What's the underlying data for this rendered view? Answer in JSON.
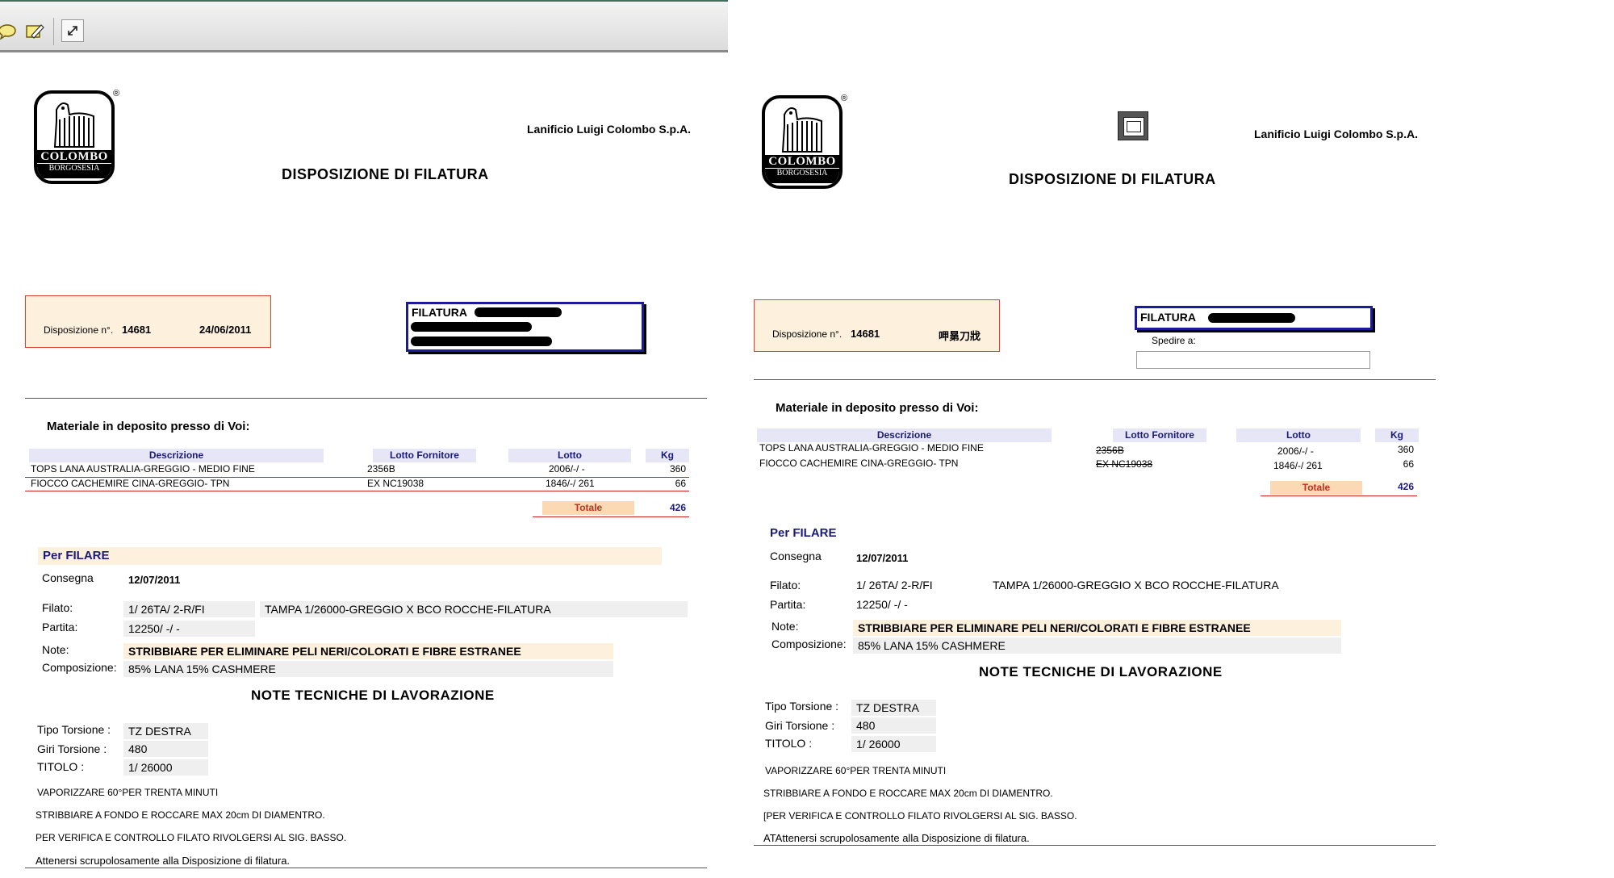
{
  "toolbar": {
    "icons": [
      "comment-icon",
      "highlight-edit-icon",
      "expand-icon"
    ]
  },
  "left": {
    "logo": {
      "brand": "COLOMBO",
      "sub": "BORGOSESIA",
      "registered": "®"
    },
    "company": "Lanificio Luigi Colombo S.p.A.",
    "title": "DISPOSIZIONE DI FILATURA",
    "disp_label": "Disposizione n°.",
    "disp_number": "14681",
    "disp_date": "24/06/2011",
    "filatura_label": "FILATURA",
    "section_title": "Materiale in deposito presso di Voi:",
    "headers": {
      "descrizione": "Descrizione",
      "lotto_fornitore": "Lotto Fornitore",
      "lotto": "Lotto",
      "kg": "Kg"
    },
    "rows": [
      {
        "descrizione": "TOPS LANA AUSTRALIA-GREGGIO - MEDIO FINE",
        "lotto_fornitore": "2356B",
        "lotto": "2006/-/  -",
        "kg": "360"
      },
      {
        "descrizione": "FIOCCO CACHEMIRE CINA-GREGGIO- TPN",
        "lotto_fornitore": "EX NC19038",
        "lotto": "1846/-/ 261",
        "kg": "66"
      }
    ],
    "totale_label": "Totale",
    "totale_value": "426",
    "per_filare": "Per  FILARE",
    "consegna_label": "Consegna",
    "consegna_value": "12/07/2011",
    "filato_label": "Filato:",
    "filato_code": "1/  26TA/   2-R/FI",
    "filato_desc": "TAMPA 1/26000-GREGGIO X BCO ROCCHE-FILATURA",
    "partita_label": "Partita:",
    "partita_value": "12250/  -/  -",
    "note_label": "Note:",
    "note_value": "STRIBBIARE PER ELIMINARE PELI NERI/COLORATI E FIBRE ESTRANEE",
    "composizione_label": "Composizione:",
    "composizione_value": "85% LANA  15% CASHMERE",
    "note_tecniche": "NOTE TECNICHE DI LAVORAZIONE",
    "tipo_torsione_label": "Tipo Torsione :",
    "tipo_torsione_value": "TZ  DESTRA",
    "giri_torsione_label": "Giri Torsione :",
    "giri_torsione_value": "480",
    "titolo_label": "TITOLO :",
    "titolo_value": "1/ 26000",
    "lines": [
      "VAPORIZZARE 60°PER TRENTA MINUTI",
      "STRIBBIARE A FONDO E ROCCARE MAX 20cm DI DIAMENTRO.",
      "PER VERIFICA E CONTROLLO FILATO RIVOLGERSI AL SIG. BASSO."
    ],
    "footer": "Attenersi scrupolosamente alla Disposizione di filatura."
  },
  "right": {
    "logo": {
      "brand": "COLOMBO",
      "sub": "BORGOSESIA",
      "registered": "®"
    },
    "company": "Lanificio Luigi Colombo S.p.A.",
    "title": "DISPOSIZIONE DI FILATURA",
    "disp_label": "Disposizione n°.",
    "disp_number": "14681",
    "disp_date": "呷晜刀戕",
    "filatura_label": "FILATURA",
    "spedire_label": "Spedire a:",
    "section_title": "Materiale in deposito presso di Voi:",
    "headers": {
      "descrizione": "Descrizione",
      "lotto_fornitore": "Lotto Fornitore",
      "lotto": "Lotto",
      "kg": "Kg"
    },
    "rows": [
      {
        "descrizione": "TOPS LANA AUSTRALIA-GREGGIO - MEDIO FINE",
        "lotto_fornitore": "2356B",
        "lotto": "2006/-/  -",
        "kg": "360"
      },
      {
        "descrizione": "FIOCCO CACHEMIRE CINA-GREGGIO- TPN",
        "lotto_fornitore": "EX NC19038",
        "lotto": "1846/-/ 261",
        "kg": "66"
      }
    ],
    "totale_label": "Totale",
    "totale_value": "426",
    "per_filare": "Per  FILARE",
    "consegna_label": "Consegna",
    "consegna_value": "12/07/2011",
    "filato_label": "Filato:",
    "filato_code": "1/  26TA/   2-R/FI",
    "filato_desc": "TAMPA 1/26000-GREGGIO X BCO ROCCHE-FILATURA",
    "partita_label": "Partita:",
    "partita_value": "12250/  -/  -",
    "note_label": "Note:",
    "note_value": "STRIBBIARE PER ELIMINARE PELI NERI/COLORATI E FIBRE ESTRANEE",
    "composizione_label": "Composizione:",
    "composizione_value": "85% LANA  15% CASHMERE",
    "note_tecniche": "NOTE TECNICHE DI LAVORAZIONE",
    "tipo_torsione_label": "Tipo Torsione :",
    "tipo_torsione_value": "TZ  DESTRA",
    "giri_torsione_label": "Giri Torsione :",
    "giri_torsione_value": "480",
    "titolo_label": "TITOLO :",
    "titolo_value": "1/ 26000",
    "lines": [
      "VAPORIZZARE 60°PER TRENTA MINUTI",
      "STRIBBIARE A FONDO E ROCCARE MAX 20cm DI DIAMENTRO.",
      "[PER VERIFICA E CONTROLLO FILATO RIVOLGERSI AL SIG. BASSO."
    ],
    "footer": "ATAttenersi scrupolosamente alla Disposizione di filatura."
  }
}
